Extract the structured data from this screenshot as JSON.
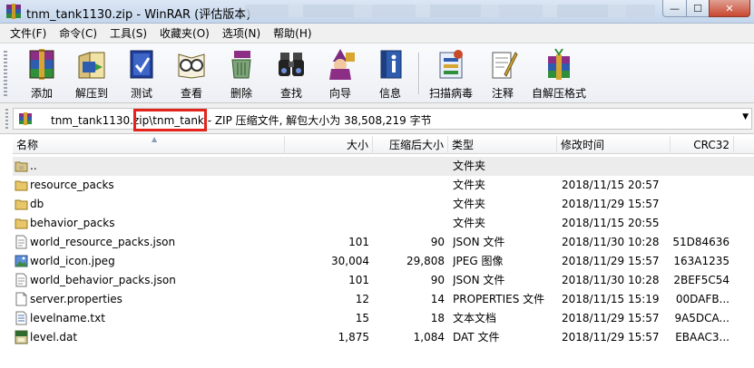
{
  "window": {
    "title": "tnm_tank1130.zip - WinRAR (评估版本)",
    "min_glyph": "—",
    "max_glyph": "☐",
    "close_glyph": "✕"
  },
  "menu": [
    "文件(F)",
    "命令(C)",
    "工具(S)",
    "收藏夹(O)",
    "选项(N)",
    "帮助(H)"
  ],
  "toolbar": [
    {
      "label": "添加",
      "icon": "add-archive-icon"
    },
    {
      "label": "解压到",
      "icon": "extract-to-icon"
    },
    {
      "label": "测试",
      "icon": "test-icon"
    },
    {
      "label": "查看",
      "icon": "view-icon"
    },
    {
      "label": "删除",
      "icon": "delete-icon"
    },
    {
      "label": "查找",
      "icon": "find-icon"
    },
    {
      "label": "向导",
      "icon": "wizard-icon"
    },
    {
      "label": "信息",
      "icon": "info-icon"
    },
    {
      "label": "扫描病毒",
      "icon": "virus-scan-icon"
    },
    {
      "label": "注释",
      "icon": "comment-icon"
    },
    {
      "label": "自解压格式",
      "icon": "sfx-icon"
    }
  ],
  "path": {
    "text": "tnm_tank1130.zip\\tnm_tank - ZIP 压缩文件, 解包大小为 38,508,219 字节",
    "dropdown_glyph": "▼"
  },
  "columns": [
    "名称",
    "大小",
    "压缩后大小",
    "类型",
    "修改时间",
    "CRC32"
  ],
  "sort_glyph": "▲",
  "files": [
    {
      "name": "..",
      "size": "",
      "packed": "",
      "type": "文件夹",
      "modified": "",
      "crc": "",
      "icon": "folder-up-icon"
    },
    {
      "name": "resource_packs",
      "size": "",
      "packed": "",
      "type": "文件夹",
      "modified": "2018/11/15 20:57",
      "crc": "",
      "icon": "folder-icon"
    },
    {
      "name": "db",
      "size": "",
      "packed": "",
      "type": "文件夹",
      "modified": "2018/11/29 15:57",
      "crc": "",
      "icon": "folder-icon"
    },
    {
      "name": "behavior_packs",
      "size": "",
      "packed": "",
      "type": "文件夹",
      "modified": "2018/11/15 20:55",
      "crc": "",
      "icon": "folder-icon"
    },
    {
      "name": "world_resource_packs.json",
      "size": "101",
      "packed": "90",
      "type": "JSON 文件",
      "modified": "2018/11/30 10:28",
      "crc": "51D84636",
      "icon": "json-file-icon"
    },
    {
      "name": "world_icon.jpeg",
      "size": "30,004",
      "packed": "29,808",
      "type": "JPEG 图像",
      "modified": "2018/11/29 15:57",
      "crc": "163A1235",
      "icon": "image-file-icon"
    },
    {
      "name": "world_behavior_packs.json",
      "size": "101",
      "packed": "90",
      "type": "JSON 文件",
      "modified": "2018/11/30 10:28",
      "crc": "2BEF5C54",
      "icon": "json-file-icon"
    },
    {
      "name": "server.properties",
      "size": "12",
      "packed": "14",
      "type": "PROPERTIES 文件",
      "modified": "2018/11/15 15:19",
      "crc": "00DAFB...",
      "icon": "blank-file-icon"
    },
    {
      "name": "levelname.txt",
      "size": "15",
      "packed": "18",
      "type": "文本文档",
      "modified": "2018/11/29 15:57",
      "crc": "9A5DCA...",
      "icon": "text-file-icon"
    },
    {
      "name": "level.dat",
      "size": "1,875",
      "packed": "1,084",
      "type": "DAT 文件",
      "modified": "2018/11/29 15:57",
      "crc": "EBAAC3...",
      "icon": "dat-file-icon"
    }
  ]
}
